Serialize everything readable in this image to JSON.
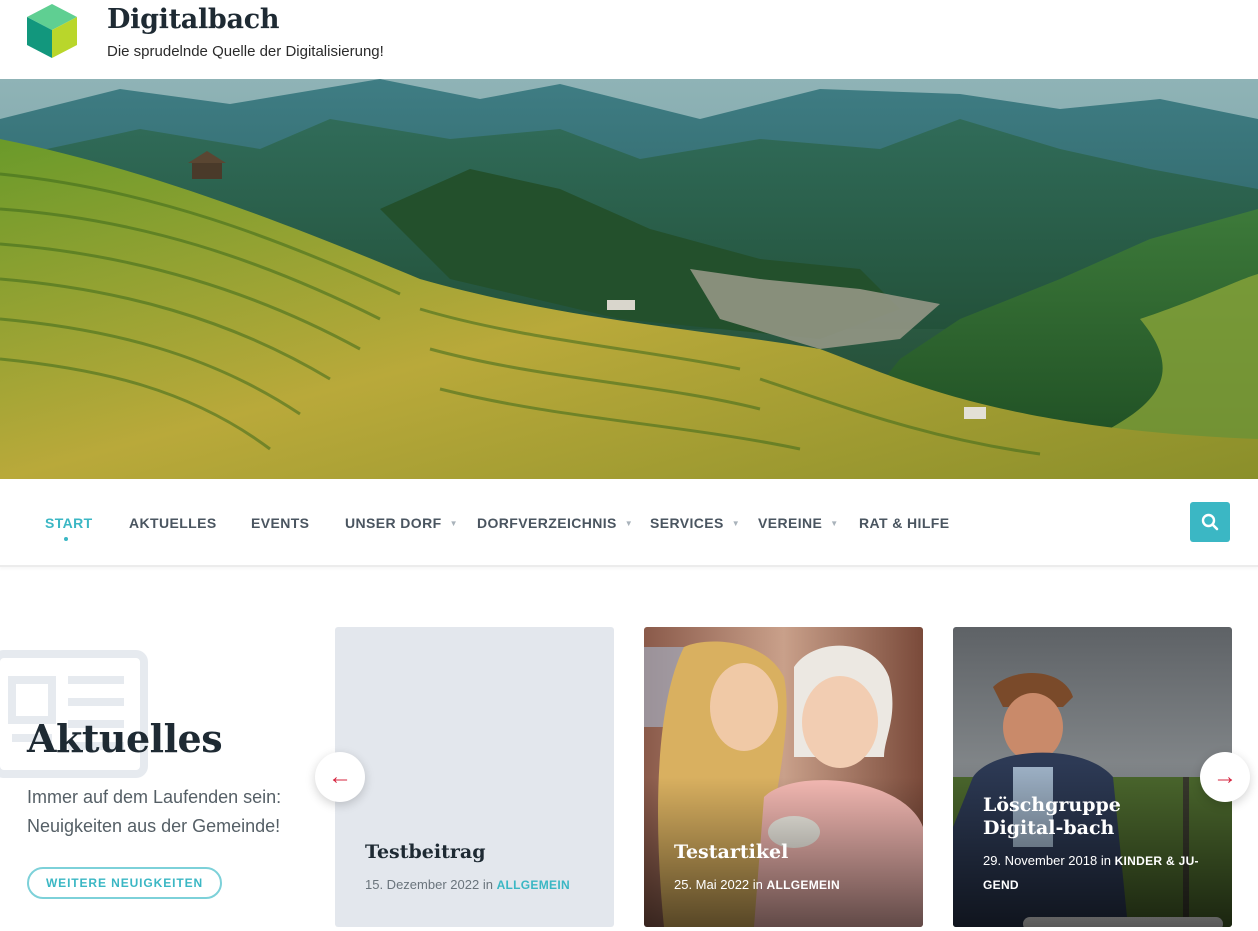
{
  "header": {
    "site_title": "Digitalbach",
    "tagline": "Die sprudelnde Quelle der Digitalisierung!"
  },
  "nav": {
    "items": [
      {
        "label": "START",
        "active": true
      },
      {
        "label": "AKTUELLES"
      },
      {
        "label": "EVENTS"
      },
      {
        "label": "UNSER DORF",
        "has_submenu": true
      },
      {
        "label": "DORFVERZEICHNIS",
        "has_submenu": true
      },
      {
        "label": "SERVICES",
        "has_submenu": true
      },
      {
        "label": "VEREINE",
        "has_submenu": true
      },
      {
        "label": "RAT & HILFE"
      }
    ]
  },
  "news": {
    "heading": "Aktuelles",
    "intro": "Immer auf dem Laufenden sein: Neuigkeiten aus der Gemeinde!",
    "more_button": "WEITERE NEUIGKEITEN",
    "prev_arrow": "←",
    "next_arrow": "→",
    "cards": [
      {
        "title": "Testbeitrag",
        "date": "15. Dezember 2022",
        "in": "in",
        "category": "ALLGEMEIN"
      },
      {
        "title": "Testartikel",
        "date": "25. Mai 2022",
        "in": "in",
        "category": "ALLGEMEIN"
      },
      {
        "title": "Löschgruppe Digital-bach",
        "date": "29. November 2018",
        "in": "in",
        "category": "KINDER & JU-GEND"
      }
    ]
  },
  "colors": {
    "accent": "#3bb7c4",
    "arrow": "#d6243f",
    "heading": "#1e2a33"
  },
  "icons": {
    "logo": "cube-logo",
    "search": "search-icon",
    "news": "newspaper-icon"
  }
}
